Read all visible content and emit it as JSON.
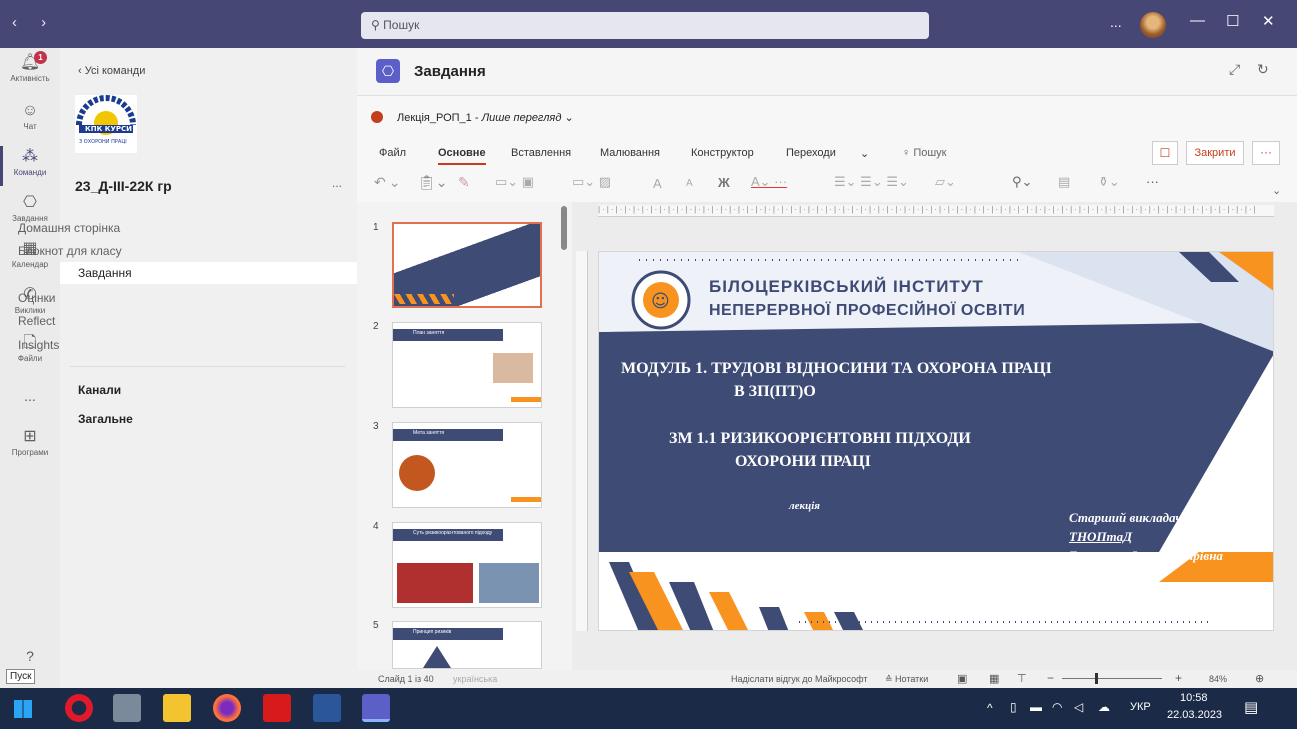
{
  "titlebar": {
    "search_placeholder": "Пошук",
    "more": "...",
    "window_controls": [
      "—",
      "☐",
      "✕"
    ]
  },
  "rail": {
    "items": [
      {
        "label": "Активність",
        "icon": "bell-icon",
        "badge": "1"
      },
      {
        "label": "Чат",
        "icon": "chat-icon"
      },
      {
        "label": "Команди",
        "icon": "teams-icon"
      },
      {
        "label": "Завдання",
        "icon": "assignments-icon"
      },
      {
        "label": "Календар",
        "icon": "calendar-icon"
      },
      {
        "label": "Виклики",
        "icon": "phone-icon"
      },
      {
        "label": "Файли",
        "icon": "file-icon"
      },
      {
        "label": "...",
        "icon": "more-icon"
      },
      {
        "label": "Програми",
        "icon": "apps-icon"
      },
      {
        "label": "?",
        "icon": "help-icon"
      }
    ]
  },
  "panel": {
    "back": "Усі команди",
    "logo_text": "КПК КУРСИ З ОХОРОНИ ПРАЦІ",
    "team_name": "23_Д-ІІІ-22К гр",
    "team_more": "...",
    "links": [
      "Домашня сторінка",
      "Блокнот для класу",
      "Завдання",
      "Оцінки",
      "Reflect",
      "Insights"
    ],
    "channels_title": "Канали",
    "channel": "Загальне"
  },
  "header": {
    "title": "Завдання"
  },
  "ppt": {
    "file_name": "Лекція_РОП_1",
    "mode": "Лише перегляд",
    "tabs": [
      "Файл",
      "Основне",
      "Вставлення",
      "Малювання",
      "Конструктор",
      "Переходи"
    ],
    "search": "Пошук",
    "close_button": "Закрити",
    "font_a_big": "A",
    "font_a_small": "A",
    "bold": "Ж"
  },
  "thumbnails": [
    {
      "num": "1",
      "title": "БІЛОЦЕРКІВСЬКИЙ ІНСТИТУТ НЕПЕРЕРВНОЇ ПРОФЕСІЙНОЇ ОСВІТИ"
    },
    {
      "num": "2",
      "title": "План заняття"
    },
    {
      "num": "3",
      "title": "Мета заняття"
    },
    {
      "num": "4",
      "title": "Суть ризикоорієнтованого підходу"
    },
    {
      "num": "5",
      "title": "Принцип ризиків"
    }
  ],
  "slide": {
    "institute_line1": "БІЛОЦЕРКІВСЬКИЙ ІНСТИТУТ",
    "institute_line2": "НЕПЕРЕРВНОЇ ПРОФЕСІЙНОЇ ОСВІТИ",
    "module_line1": "МОДУЛЬ 1. ТРУДОВІ ВІДНОСИНИ ТА ОХОРОНА ПРАЦІ",
    "module_line2": "В ЗП(ПТ)О",
    "sm_line1": "ЗМ 1.1  РИЗИКООРІЄНТОВНІ ПІДХОДИ",
    "sm_line2": "ОХОРОНИ ПРАЦІ",
    "kind": "лекція",
    "author_line1": "Старший викладач кафедри",
    "author_line2": "ТНОПтаД",
    "author_line3": "Гончарова Ірина Петрівна"
  },
  "status": {
    "slide_info": "Слайд 1 із 40",
    "language": "українська",
    "feedback": "Надіслати відгук до Майкрософт",
    "notes": "Нотатки",
    "zoom": "84%"
  },
  "taskbar": {
    "start_tooltip": "Пуск",
    "lang": "УКР",
    "time": "10:58",
    "date": "22.03.2023"
  },
  "colors": {
    "teams_purple": "#464775",
    "slide_navy": "#3d4b75",
    "slide_orange": "#f7931e",
    "ppt_red": "#c43e1c"
  }
}
